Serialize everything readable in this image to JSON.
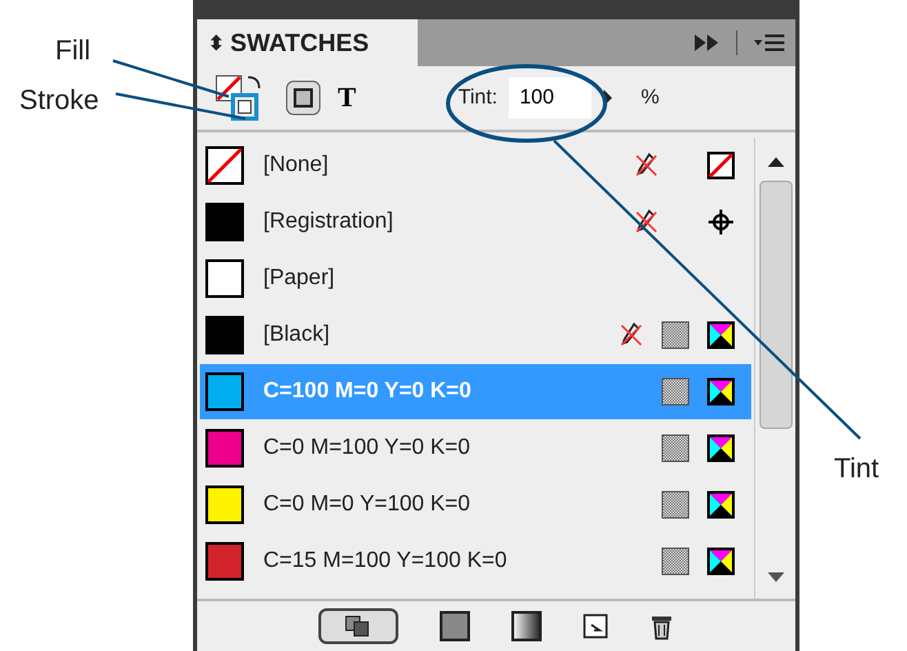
{
  "panel": {
    "toggle": "⬍",
    "title": "SWATCHES"
  },
  "toolbar": {
    "tint_label": "Tint:",
    "tint_value": "100",
    "percent": "%",
    "text_glyph": "T"
  },
  "swatches": [
    {
      "name": "[None]",
      "kind": "none",
      "color": "#ffffff",
      "locked": true,
      "selected": false
    },
    {
      "name": "[Registration]",
      "kind": "registration",
      "color": "#000000",
      "locked": true,
      "selected": false
    },
    {
      "name": "[Paper]",
      "kind": "paper",
      "color": "#ffffff",
      "locked": false,
      "selected": false
    },
    {
      "name": "[Black]",
      "kind": "process",
      "color": "#000000",
      "locked": true,
      "selected": false
    },
    {
      "name": "C=100 M=0 Y=0 K=0",
      "kind": "process",
      "color": "#00aeef",
      "locked": false,
      "selected": true
    },
    {
      "name": "C=0 M=100 Y=0 K=0",
      "kind": "process",
      "color": "#ec008c",
      "locked": false,
      "selected": false
    },
    {
      "name": "C=0 M=0 Y=100 K=0",
      "kind": "process",
      "color": "#fff200",
      "locked": false,
      "selected": false
    },
    {
      "name": "C=15 M=100 Y=100 K=0",
      "kind": "process",
      "color": "#d2232a",
      "locked": false,
      "selected": false
    }
  ],
  "callouts": [
    {
      "label": "Fill"
    },
    {
      "label": "Stroke"
    },
    {
      "label": "Tint"
    }
  ]
}
